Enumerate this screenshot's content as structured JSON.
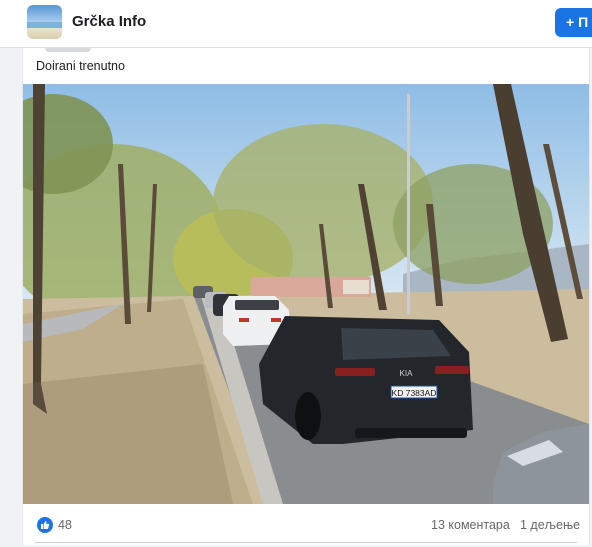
{
  "header": {
    "page_name": "Grčka Info",
    "follow_label": "+ П",
    "avatar_icon": "beach-landscape-icon"
  },
  "post": {
    "caption": "Doirani trenutno",
    "photo": {
      "description_icon": "street-photo",
      "license_plate": "KD 7383AD",
      "car_badge": "KIA"
    },
    "reactions": {
      "icon": "thumbs-up-icon",
      "count": "48"
    },
    "comments_label": "13 коментара",
    "shares_label": "1 дељење"
  },
  "colors": {
    "accent": "#1b74e4",
    "background": "#f0f2f5",
    "card": "#ffffff",
    "secondary_text": "#65676b"
  }
}
